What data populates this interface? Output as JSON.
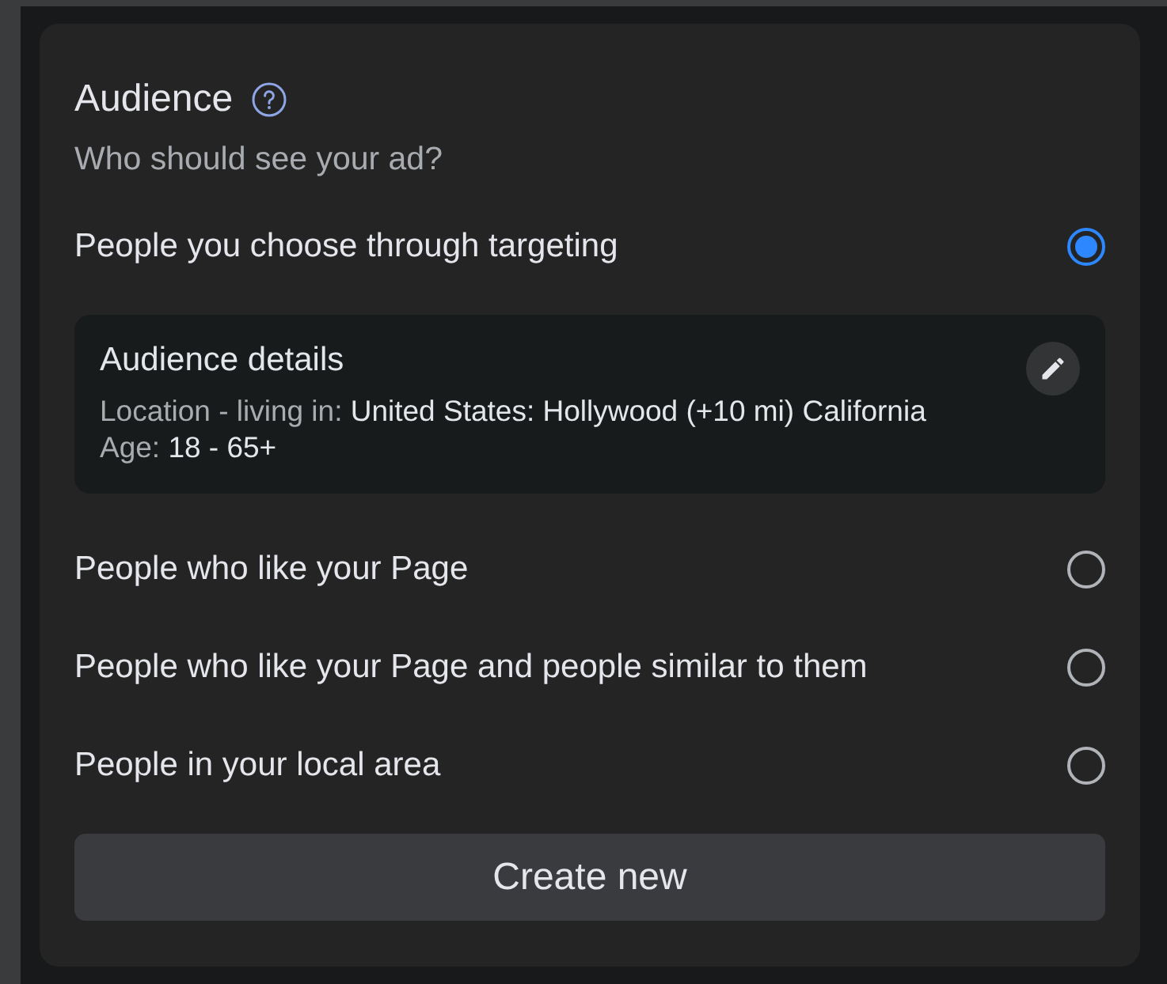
{
  "title": "Audience",
  "subtitle": "Who should see your ad?",
  "options": [
    {
      "label": "People you choose through targeting",
      "selected": true,
      "details": {
        "title": "Audience details",
        "lines": [
          {
            "label": "Location - living in:",
            "value": "United States: Hollywood (+10 mi) California"
          },
          {
            "label": "Age:",
            "value": "18 - 65+"
          }
        ]
      }
    },
    {
      "label": "People who like your Page",
      "selected": false
    },
    {
      "label": "People who like your Page and people similar to them",
      "selected": false
    },
    {
      "label": "People in your local area",
      "selected": false
    }
  ],
  "button": "Create new"
}
